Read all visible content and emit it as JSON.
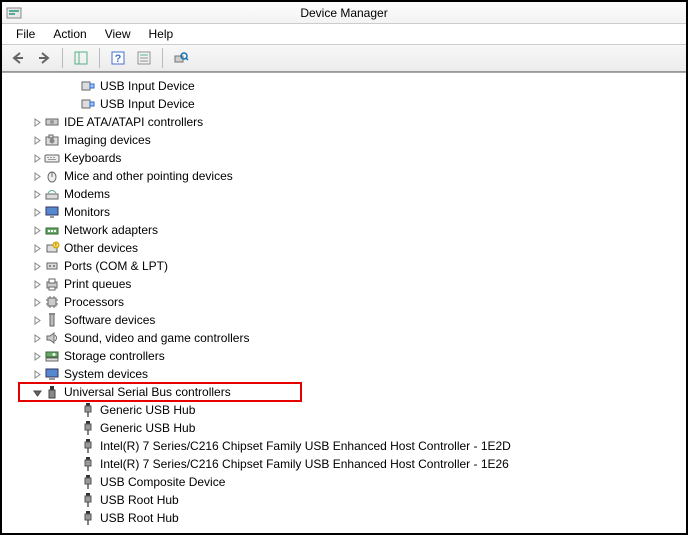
{
  "title": "Device Manager",
  "menu": [
    "File",
    "Action",
    "View",
    "Help"
  ],
  "tree": [
    {
      "level": 3,
      "exp": "",
      "icon": "usb-dev",
      "label": "USB Input Device"
    },
    {
      "level": 3,
      "exp": "",
      "icon": "usb-dev",
      "label": "USB Input Device"
    },
    {
      "level": 1,
      "exp": "collapsed",
      "icon": "ide",
      "label": "IDE ATA/ATAPI controllers"
    },
    {
      "level": 1,
      "exp": "collapsed",
      "icon": "camera",
      "label": "Imaging devices"
    },
    {
      "level": 1,
      "exp": "collapsed",
      "icon": "keyboard",
      "label": "Keyboards"
    },
    {
      "level": 1,
      "exp": "collapsed",
      "icon": "mouse",
      "label": "Mice and other pointing devices"
    },
    {
      "level": 1,
      "exp": "collapsed",
      "icon": "modem",
      "label": "Modems"
    },
    {
      "level": 1,
      "exp": "collapsed",
      "icon": "monitor",
      "label": "Monitors"
    },
    {
      "level": 1,
      "exp": "collapsed",
      "icon": "network",
      "label": "Network adapters"
    },
    {
      "level": 1,
      "exp": "collapsed",
      "icon": "other",
      "label": "Other devices"
    },
    {
      "level": 1,
      "exp": "collapsed",
      "icon": "port",
      "label": "Ports (COM & LPT)"
    },
    {
      "level": 1,
      "exp": "collapsed",
      "icon": "printer",
      "label": "Print queues"
    },
    {
      "level": 1,
      "exp": "collapsed",
      "icon": "cpu",
      "label": "Processors"
    },
    {
      "level": 1,
      "exp": "collapsed",
      "icon": "software",
      "label": "Software devices"
    },
    {
      "level": 1,
      "exp": "collapsed",
      "icon": "audio",
      "label": "Sound, video and game controllers"
    },
    {
      "level": 1,
      "exp": "collapsed",
      "icon": "storage",
      "label": "Storage controllers"
    },
    {
      "level": 1,
      "exp": "collapsed",
      "icon": "system",
      "label": "System devices"
    },
    {
      "level": 1,
      "exp": "expanded",
      "icon": "usb-cat",
      "label": "Universal Serial Bus controllers",
      "highlight": true
    },
    {
      "level": 3,
      "exp": "",
      "icon": "usb-plug",
      "label": "Generic USB Hub"
    },
    {
      "level": 3,
      "exp": "",
      "icon": "usb-plug",
      "label": "Generic USB Hub"
    },
    {
      "level": 3,
      "exp": "",
      "icon": "usb-plug",
      "label": "Intel(R) 7 Series/C216 Chipset Family USB Enhanced Host Controller - 1E2D"
    },
    {
      "level": 3,
      "exp": "",
      "icon": "usb-plug",
      "label": "Intel(R) 7 Series/C216 Chipset Family USB Enhanced Host Controller - 1E26"
    },
    {
      "level": 3,
      "exp": "",
      "icon": "usb-plug",
      "label": "USB Composite Device"
    },
    {
      "level": 3,
      "exp": "",
      "icon": "usb-plug",
      "label": "USB Root Hub"
    },
    {
      "level": 3,
      "exp": "",
      "icon": "usb-plug",
      "label": "USB Root Hub"
    }
  ]
}
